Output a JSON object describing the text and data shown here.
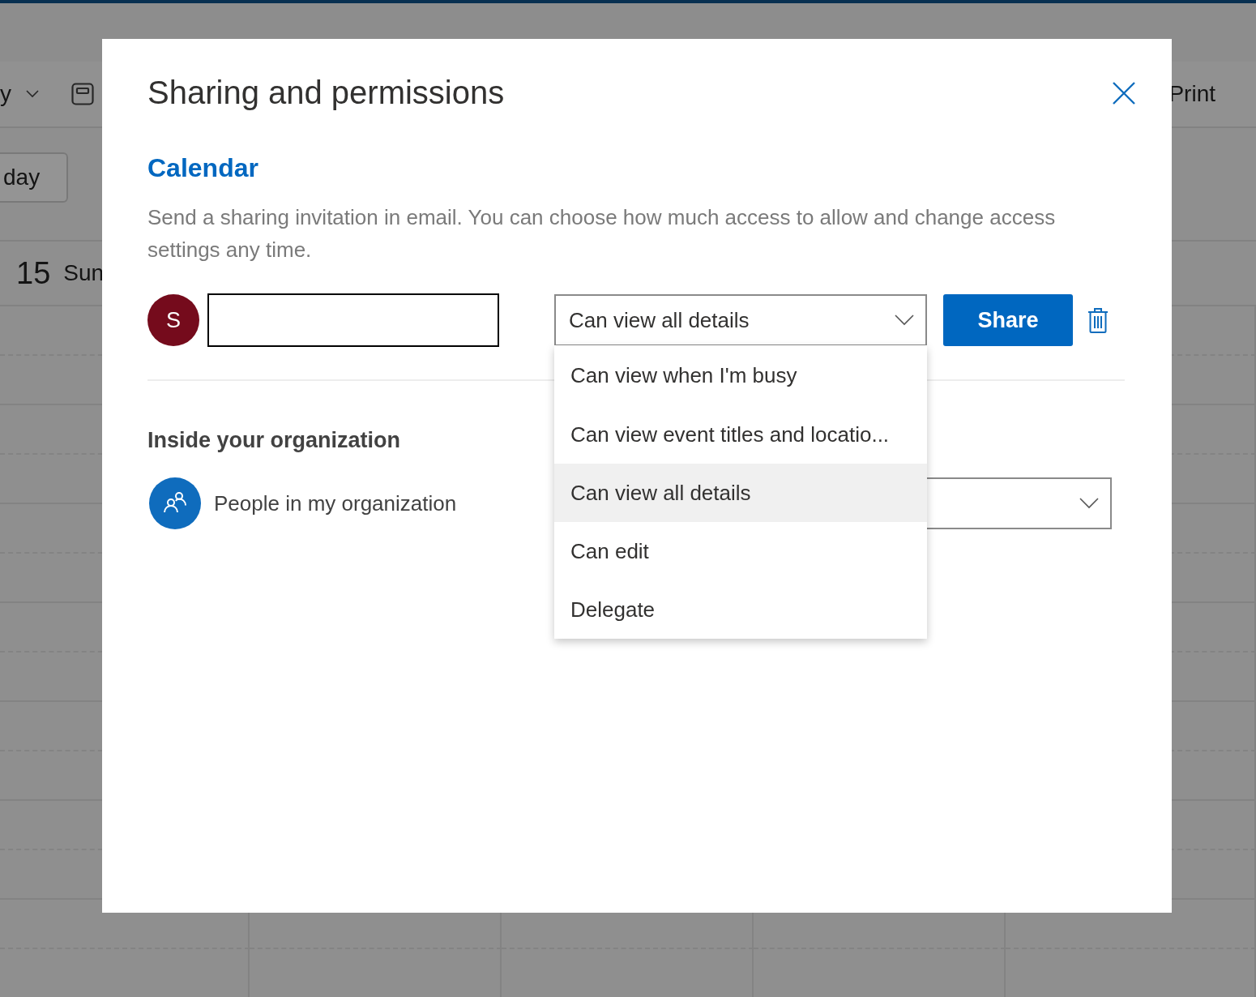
{
  "background": {
    "toolbar": [
      {
        "kind": "dropdown",
        "label": "y"
      },
      {
        "kind": "view"
      },
      {
        "kind": "print",
        "label": "Print"
      }
    ],
    "today_button": "day",
    "date": {
      "day": "15",
      "weekday": "Sun"
    }
  },
  "dialog": {
    "title": "Sharing and permissions",
    "section_title": "Calendar",
    "description": "Send a sharing invitation in email. You can choose how much access to allow and change access settings any time.",
    "invite": {
      "avatar_initial": "S",
      "permission": {
        "value": "Can view all details",
        "expanded": true
      },
      "share_button": "Share"
    },
    "permission_options": [
      {
        "label": "Can view when I'm busy",
        "selected": false
      },
      {
        "label": "Can view event titles and locatio...",
        "selected": false
      },
      {
        "label": "Can view all details",
        "selected": true
      },
      {
        "label": "Can edit",
        "selected": false
      },
      {
        "label": "Delegate",
        "selected": false
      }
    ],
    "organization": {
      "heading": "Inside your organization",
      "entries": [
        {
          "name": "People in my organization"
        }
      ]
    }
  }
}
